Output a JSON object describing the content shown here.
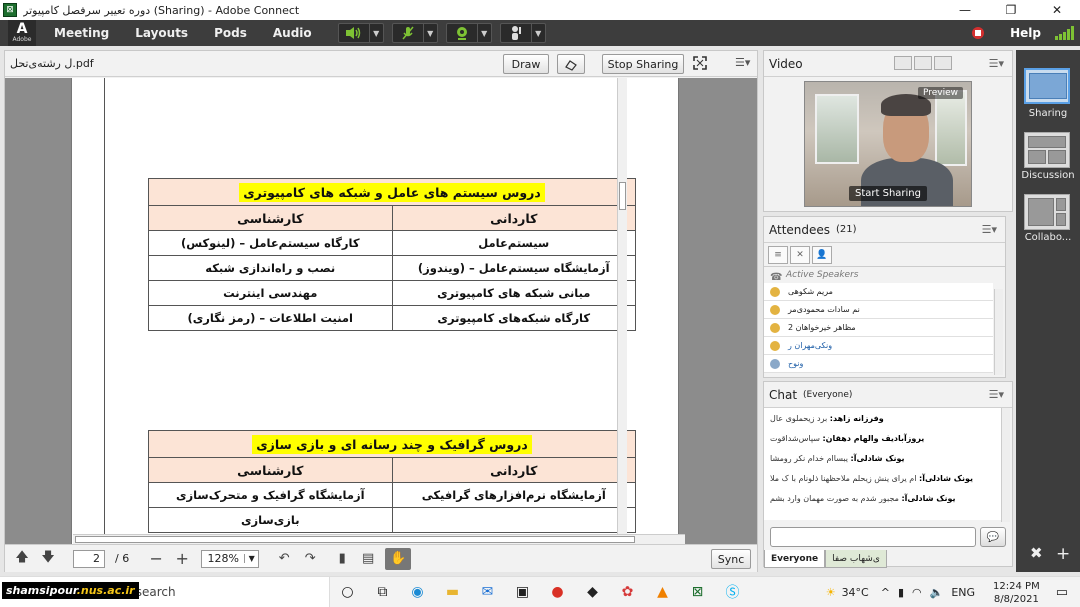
{
  "window": {
    "title": "دوره تعییر سرفصل کامپیوتر (Sharing) - Adobe Connect",
    "minimize": "—",
    "maximize": "❐",
    "close": "✕"
  },
  "menubar": {
    "logo_text": "Adobe",
    "items": [
      "Meeting",
      "Layouts",
      "Pods",
      "Audio"
    ],
    "help": "Help"
  },
  "share_pod": {
    "title": "ل رشته‌ی‌تحل.pdf",
    "draw_button": "Draw",
    "stop_sharing_button": "Stop Sharing",
    "page_current": "2",
    "page_total": "/ 6",
    "zoom": "128%",
    "sync_button": "Sync"
  },
  "doc": {
    "table1": {
      "title": "دروس سیستم های عامل و  شبکه های کامپیوتری",
      "col_right": "کاردانی",
      "col_left": "کارشناسی",
      "rows": [
        [
          "سیستم‌عامل",
          "کارگاه سیستم‌عامل – (لینوکس)"
        ],
        [
          "آزمایشگاه سیستم‌عامل  – (ویندوز)",
          "نصب و راه‌اندازی شبکه"
        ],
        [
          "مبانی شبکه های کامپیوتری",
          "مهندسی اینترنت"
        ],
        [
          "کارگاه شبکه‌های کامپیوتری",
          "امنیت اطلاعات – (رمز نگاری)"
        ]
      ]
    },
    "table2": {
      "title": "دروس گرافیک و چند رسانه ای و بازی سازی",
      "col_right": "کاردانی",
      "col_left": "کارشناسی",
      "rows": [
        [
          "آزمایشگاه نرم‌افزارهای گرافیکی",
          "آزمایشگاه گرافیک و متحرک‌سازی"
        ],
        [
          "",
          "بازی‌سازی"
        ]
      ]
    }
  },
  "video_pod": {
    "title": "Video",
    "preview_label": "Preview",
    "start_sharing": "Start Sharing"
  },
  "attendees_pod": {
    "title": "Attendees",
    "count": "(21)",
    "section": "Active Speakers",
    "people": [
      "مریم شکوهی",
      "نم سادات محمودی‌مر",
      "مظاهر خیرخواهان 2",
      "ونکی‌مهران ر",
      "ونوح"
    ]
  },
  "chat_pod": {
    "title": "Chat",
    "scope": "(Everyone)",
    "messages": [
      {
        "sender": "وفرزانه زاهد:",
        "text": " برد زیحملوی عال"
      },
      {
        "sender": "یروزآبادیف والهام دهقان:",
        "text": " سپاس‌شداقوت"
      },
      {
        "sender": "یونک شادلی‌آ:",
        "text": " یبساام خدام نکر رومشا"
      },
      {
        "sender": "یونک شادلی‌آ:",
        "text": " ام یرای ینش زیحلم ملاحظهنا ذلونام با ک ملا"
      },
      {
        "sender": "یونک شادلی‌آ:",
        "text": " مجبور شدم به صورت مهمان وارد بشم"
      }
    ],
    "send_icon": "💬",
    "tabs": [
      "Everyone",
      "ی‌شهاب صفا"
    ]
  },
  "layouts": {
    "items": [
      "Sharing",
      "Discussion",
      "Collabo..."
    ]
  },
  "taskbar": {
    "watermark_a": "shamsipour",
    "watermark_b": ".nus.ac.ir",
    "search_text": "re to search",
    "weather": "34°C",
    "lang": "ENG",
    "time": "12:24 PM",
    "date": "8/8/2021"
  },
  "colors": {
    "table_header_bg": "#fce4d6",
    "title_highlight": "#ffff00",
    "menubar_bg": "#3d3d3d",
    "layout_active": "#5aa0e6"
  }
}
